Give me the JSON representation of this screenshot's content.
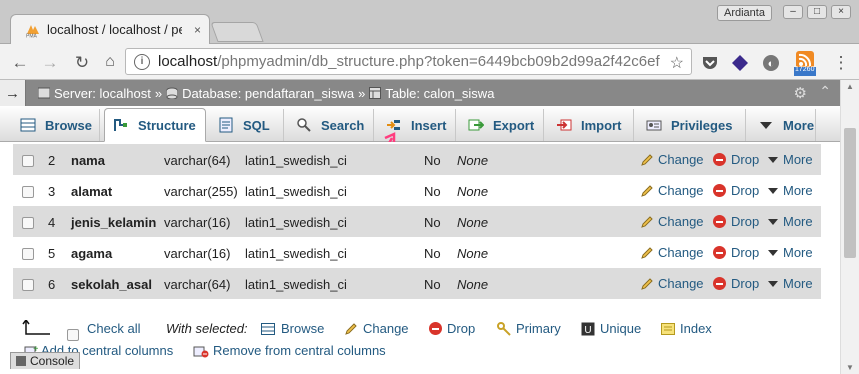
{
  "browser": {
    "tab_title": "localhost / localhost / pe",
    "tab_close": "×",
    "profile_name": "Ardianta",
    "url_host": "localhost",
    "url_path": "/phpmyadmin/db_structure.php?token=6449bcb09b2d99a2f42c6ef",
    "badge_count": "17260"
  },
  "breadcrumb": {
    "toggle": "→",
    "server_label": "Server: localhost",
    "database_label": "Database: pendaftaran_siswa",
    "table_label": "Table: calon_siswa",
    "separator": "»"
  },
  "tabs": [
    {
      "label": "Browse",
      "icon": "browse-icon"
    },
    {
      "label": "Structure",
      "icon": "structure-icon"
    },
    {
      "label": "SQL",
      "icon": "sql-icon"
    },
    {
      "label": "Search",
      "icon": "search-icon"
    },
    {
      "label": "Insert",
      "icon": "insert-icon"
    },
    {
      "label": "Export",
      "icon": "export-icon"
    },
    {
      "label": "Import",
      "icon": "import-icon"
    },
    {
      "label": "Privileges",
      "icon": "privileges-icon"
    },
    {
      "label": "More",
      "icon": "chevron-down-icon"
    }
  ],
  "rows": [
    {
      "num": "2",
      "name": "nama",
      "type": "varchar(64)",
      "collation": "latin1_swedish_ci",
      "null": "No",
      "default": "None"
    },
    {
      "num": "3",
      "name": "alamat",
      "type": "varchar(255)",
      "collation": "latin1_swedish_ci",
      "null": "No",
      "default": "None"
    },
    {
      "num": "4",
      "name": "jenis_kelamin",
      "type": "varchar(16)",
      "collation": "latin1_swedish_ci",
      "null": "No",
      "default": "None"
    },
    {
      "num": "5",
      "name": "agama",
      "type": "varchar(16)",
      "collation": "latin1_swedish_ci",
      "null": "No",
      "default": "None"
    },
    {
      "num": "6",
      "name": "sekolah_asal",
      "type": "varchar(64)",
      "collation": "latin1_swedish_ci",
      "null": "No",
      "default": "None"
    }
  ],
  "row_actions": {
    "change": "Change",
    "drop": "Drop",
    "more": "More"
  },
  "bulk": {
    "check_all": "Check all",
    "with_selected": "With selected:",
    "browse": "Browse",
    "change": "Change",
    "drop": "Drop",
    "primary": "Primary",
    "unique": "Unique",
    "index": "Index",
    "add_central": "Add to central columns",
    "remove_central": "Remove from central columns"
  },
  "console_label": "Console",
  "colors": {
    "pma_link": "#235a81",
    "breadcrumb_bg": "#888888",
    "drop_red": "#d9342b",
    "annotation_arrow": "#ff3d7f"
  }
}
